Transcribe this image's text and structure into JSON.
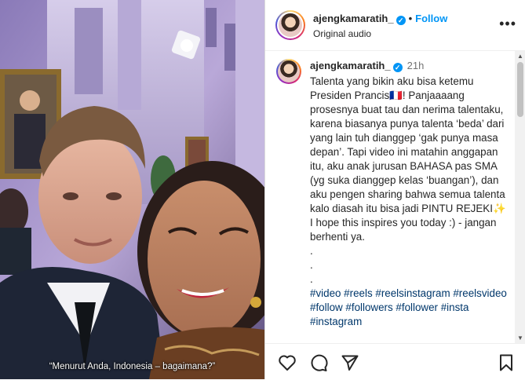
{
  "media": {
    "caption": "“Menurut Anda, Indonesia – bagaimana?”"
  },
  "header": {
    "username": "ajengkamaratih_",
    "follow_label": "Follow",
    "audio_label": "Original audio",
    "more_icon": "more-horizontal-icon"
  },
  "comment": {
    "username": "ajengkamaratih_",
    "time": "21h",
    "body": "Talenta yang bikin aku bisa ketemu Presiden Prancis🇫🇷! Panjaaaang prosesnya buat tau dan nerima talentaku, karena biasanya punya talenta ‘beda’ dari yang lain tuh dianggep ‘gak punya masa depan’. Tapi video ini matahin anggapan itu, aku anak jurusan BAHASA pas SMA (yg suka dianggep kelas ‘buangan’), dan aku pengen sharing bahwa semua talenta kalo diasah itu bisa jadi PINTU REJEKI✨ I hope this inspires you today :) - jangan berhenti ya.\n.\n.\n.",
    "hashtags": "#video #reels #reelsinstagram #reelsvideo #follow #followers #follower #insta #instagram"
  },
  "actions": {
    "like_icon": "heart-icon",
    "comment_icon": "comment-icon",
    "share_icon": "send-icon",
    "save_icon": "bookmark-icon"
  },
  "colors": {
    "link": "#0095f6",
    "hashtag": "#00376b",
    "text": "#262626"
  }
}
